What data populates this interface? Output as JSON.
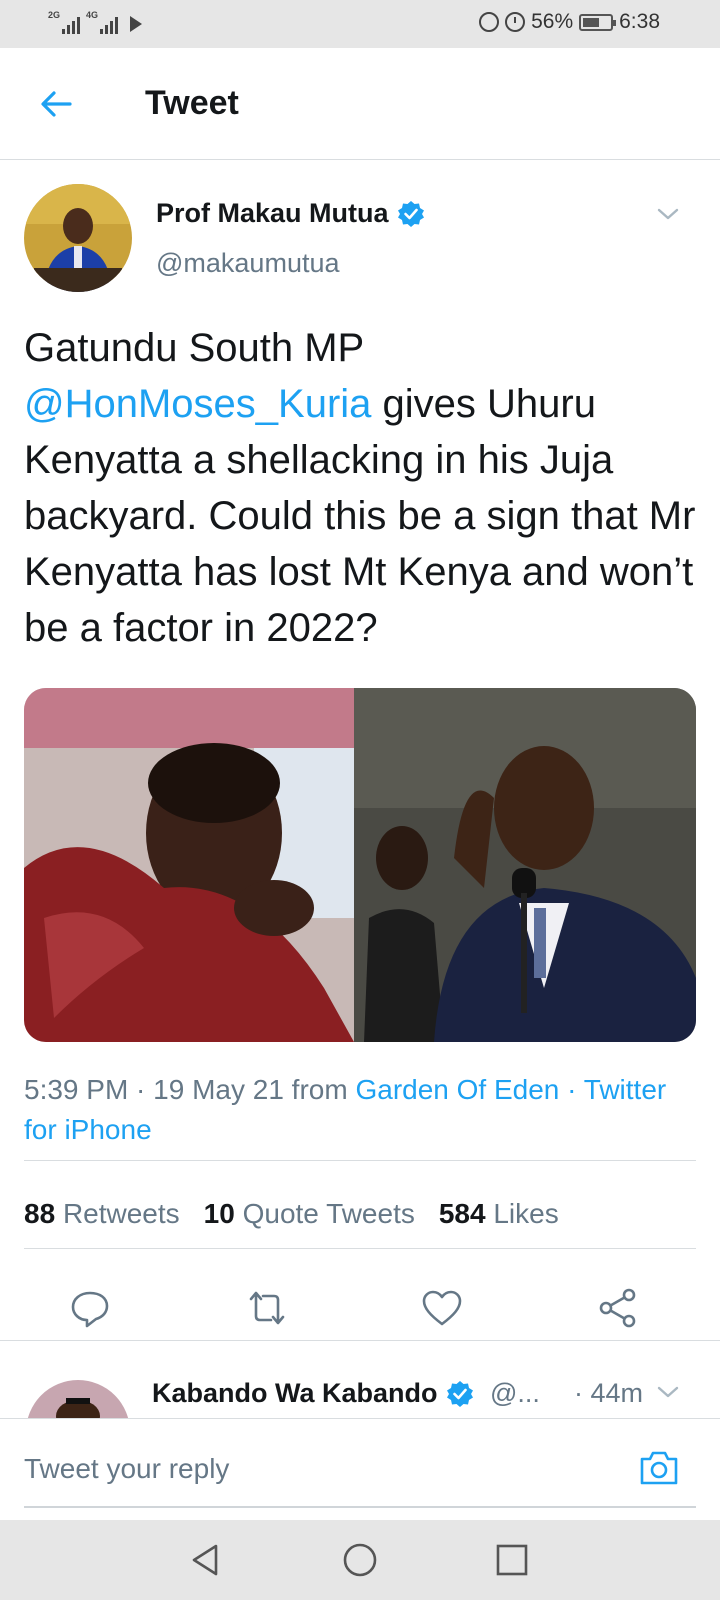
{
  "status_bar": {
    "net1": "2G",
    "net2": "4G",
    "battery_percent": "56%",
    "time": "6:38"
  },
  "header": {
    "title": "Tweet"
  },
  "tweet": {
    "author_name": "Prof Makau Mutua",
    "author_handle": "@makaumutua",
    "text_before": "Gatundu South MP ",
    "mention": "@HonMoses_Kuria",
    "text_after": " gives Uhuru Kenyatta a shellacking in his Juja backyard. Could this be a sign that Mr Kenyatta has lost Mt Kenya and won’t be a factor in 2022?",
    "timestamp": "5:39 PM · 19 May 21 from ",
    "location": "Garden Of Eden",
    "separator": " · ",
    "source": "Twitter for iPhone",
    "retweets_count": "88",
    "retweets_label": "Retweets",
    "quotes_count": "10",
    "quotes_label": "Quote Tweets",
    "likes_count": "584",
    "likes_label": "Likes"
  },
  "reply_preview": {
    "name": "Kabando Wa Kabando",
    "handle": "@...",
    "time": "· 44m"
  },
  "compose": {
    "placeholder": "Tweet your reply"
  },
  "colors": {
    "accent": "#1da1f2",
    "secondary_text": "#657786",
    "primary_text": "#14171a"
  }
}
